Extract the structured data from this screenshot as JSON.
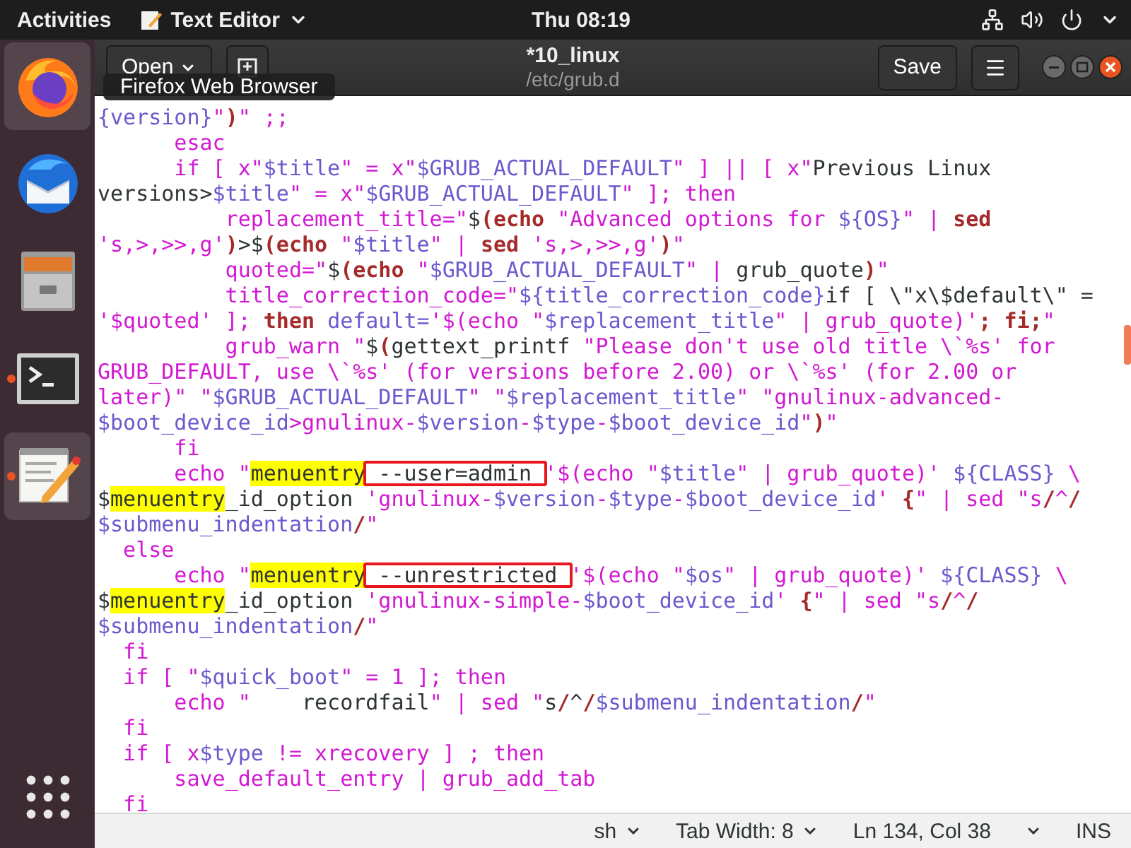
{
  "top_bar": {
    "activities": "Activities",
    "app_menu": "Text Editor",
    "clock": "Thu 08:19"
  },
  "dock": {
    "items": [
      {
        "kind": "firefox",
        "running": false,
        "highlighted": true
      },
      {
        "kind": "thunderbird",
        "running": false,
        "highlighted": false
      },
      {
        "kind": "files",
        "running": false,
        "highlighted": false
      },
      {
        "kind": "terminal",
        "running": true,
        "highlighted": false
      },
      {
        "kind": "text-editor",
        "running": true,
        "highlighted": true
      }
    ]
  },
  "tooltip": "Firefox Web Browser",
  "header": {
    "open_button": "Open",
    "title": "*10_linux",
    "subtitle": "/etc/grub.d",
    "save_button": "Save"
  },
  "editor": {
    "lines": [
      [
        {
          "kind": "variable",
          "text": "{version}"
        },
        {
          "kind": "string",
          "text": "\""
        },
        {
          "kind": "keyword",
          "text": ")"
        },
        {
          "kind": "string",
          "text": "\" ;;"
        }
      ],
      [
        {
          "kind": "string",
          "text": "      esac"
        }
      ],
      [
        {
          "kind": "string",
          "text": "      if [ x\""
        },
        {
          "kind": "variable",
          "text": "$title"
        },
        {
          "kind": "string",
          "text": "\" = x\""
        },
        {
          "kind": "variable",
          "text": "$GRUB_ACTUAL_DEFAULT"
        },
        {
          "kind": "string",
          "text": "\" ] || [ x\""
        },
        {
          "kind": "plain",
          "text": "Previous Linux"
        }
      ],
      [
        {
          "kind": "plain",
          "text": "versions>"
        },
        {
          "kind": "variable",
          "text": "$title"
        },
        {
          "kind": "string",
          "text": "\" = x\""
        },
        {
          "kind": "variable",
          "text": "$GRUB_ACTUAL_DEFAULT"
        },
        {
          "kind": "string",
          "text": "\" ]; then"
        }
      ],
      [
        {
          "kind": "string",
          "text": "          replacement_title=\""
        },
        {
          "kind": "plain",
          "text": "$"
        },
        {
          "kind": "keyword",
          "text": "(echo "
        },
        {
          "kind": "string",
          "text": "\"Advanced options for "
        },
        {
          "kind": "variable",
          "text": "${OS}"
        },
        {
          "kind": "string",
          "text": "\" | "
        },
        {
          "kind": "keyword",
          "text": "sed"
        }
      ],
      [
        {
          "kind": "string",
          "text": "'s,>,>>,g'"
        },
        {
          "kind": "keyword",
          "text": ")"
        },
        {
          "kind": "plain",
          "text": ">$"
        },
        {
          "kind": "keyword",
          "text": "(echo "
        },
        {
          "kind": "string",
          "text": "\""
        },
        {
          "kind": "variable",
          "text": "$title"
        },
        {
          "kind": "string",
          "text": "\" | "
        },
        {
          "kind": "keyword",
          "text": "sed "
        },
        {
          "kind": "string",
          "text": "'s,>,>>,g'"
        },
        {
          "kind": "keyword",
          "text": ")"
        },
        {
          "kind": "string",
          "text": "\""
        }
      ],
      [
        {
          "kind": "string",
          "text": "          quoted=\""
        },
        {
          "kind": "plain",
          "text": "$"
        },
        {
          "kind": "keyword",
          "text": "(echo "
        },
        {
          "kind": "string",
          "text": "\""
        },
        {
          "kind": "variable",
          "text": "$GRUB_ACTUAL_DEFAULT"
        },
        {
          "kind": "string",
          "text": "\" | "
        },
        {
          "kind": "plain",
          "text": "grub_quote"
        },
        {
          "kind": "keyword",
          "text": ")"
        },
        {
          "kind": "string",
          "text": "\""
        }
      ],
      [
        {
          "kind": "string",
          "text": "          title_correction_code=\""
        },
        {
          "kind": "variable",
          "text": "${title_correction_code}"
        },
        {
          "kind": "plain",
          "text": "if [ \\\"x\\$default\\\" ="
        }
      ],
      [
        {
          "kind": "string",
          "text": "'$quoted' ]; "
        },
        {
          "kind": "keyword",
          "text": "then "
        },
        {
          "kind": "variable",
          "text": "default="
        },
        {
          "kind": "string",
          "text": "'$(echo \""
        },
        {
          "kind": "variable",
          "text": "$replacement_title"
        },
        {
          "kind": "string",
          "text": "\" | grub_quote)'"
        },
        {
          "kind": "keyword",
          "text": "; fi;"
        },
        {
          "kind": "string",
          "text": "\""
        }
      ],
      [
        {
          "kind": "string",
          "text": "          grub_warn \""
        },
        {
          "kind": "plain",
          "text": "$"
        },
        {
          "kind": "keyword",
          "text": "("
        },
        {
          "kind": "plain",
          "text": "gettext_printf "
        },
        {
          "kind": "string",
          "text": "\"Please don't use old title \\`%s' for"
        }
      ],
      [
        {
          "kind": "string",
          "text": "GRUB_DEFAULT, use \\`%s' (for versions before 2.00) or \\`%s' (for 2.00 or"
        }
      ],
      [
        {
          "kind": "string",
          "text": "later)\" \""
        },
        {
          "kind": "variable",
          "text": "$GRUB_ACTUAL_DEFAULT"
        },
        {
          "kind": "string",
          "text": "\" \""
        },
        {
          "kind": "variable",
          "text": "$replacement_title"
        },
        {
          "kind": "string",
          "text": "\" \"gnulinux-advanced-"
        }
      ],
      [
        {
          "kind": "variable",
          "text": "$boot_device_id"
        },
        {
          "kind": "string",
          "text": ">gnulinux-"
        },
        {
          "kind": "variable",
          "text": "$version"
        },
        {
          "kind": "string",
          "text": "-"
        },
        {
          "kind": "variable",
          "text": "$type"
        },
        {
          "kind": "string",
          "text": "-"
        },
        {
          "kind": "variable",
          "text": "$boot_device_id"
        },
        {
          "kind": "string",
          "text": "\""
        },
        {
          "kind": "keyword",
          "text": ")"
        },
        {
          "kind": "string",
          "text": "\""
        }
      ],
      [
        {
          "kind": "string",
          "text": "      fi"
        }
      ],
      [
        {
          "kind": "string",
          "text": "      echo \""
        },
        {
          "kind": "match",
          "text": "menuentry"
        },
        {
          "kind": "marked",
          "text": " --user=admin "
        },
        {
          "kind": "string",
          "text": "'$(echo \""
        },
        {
          "kind": "variable",
          "text": "$title"
        },
        {
          "kind": "string",
          "text": "\" | grub_quote)' "
        },
        {
          "kind": "variable",
          "text": "${CLASS}"
        },
        {
          "kind": "string",
          "text": " \\"
        }
      ],
      [
        {
          "kind": "plain",
          "text": "$"
        },
        {
          "kind": "match",
          "text": "menuentry"
        },
        {
          "kind": "plain",
          "text": "_id_option "
        },
        {
          "kind": "string",
          "text": "'gnulinux-"
        },
        {
          "kind": "variable",
          "text": "$version"
        },
        {
          "kind": "string",
          "text": "-"
        },
        {
          "kind": "variable",
          "text": "$type"
        },
        {
          "kind": "string",
          "text": "-"
        },
        {
          "kind": "variable",
          "text": "$boot_device_id"
        },
        {
          "kind": "string",
          "text": "' "
        },
        {
          "kind": "keyword",
          "text": "{"
        },
        {
          "kind": "string",
          "text": "\" | sed \"s"
        },
        {
          "kind": "keyword",
          "text": "/"
        },
        {
          "kind": "string",
          "text": "^"
        },
        {
          "kind": "keyword",
          "text": "/"
        }
      ],
      [
        {
          "kind": "variable",
          "text": "$submenu_indentation"
        },
        {
          "kind": "keyword",
          "text": "/"
        },
        {
          "kind": "string",
          "text": "\""
        }
      ],
      [
        {
          "kind": "string",
          "text": "  else"
        }
      ],
      [
        {
          "kind": "string",
          "text": "      echo \""
        },
        {
          "kind": "match",
          "text": "menuentry"
        },
        {
          "kind": "marked",
          "text": " --unrestricted "
        },
        {
          "kind": "string",
          "text": "'$(echo \""
        },
        {
          "kind": "variable",
          "text": "$os"
        },
        {
          "kind": "string",
          "text": "\" | grub_quote)' "
        },
        {
          "kind": "variable",
          "text": "${CLASS}"
        },
        {
          "kind": "string",
          "text": " \\"
        }
      ],
      [
        {
          "kind": "plain",
          "text": "$"
        },
        {
          "kind": "match",
          "text": "menuentry"
        },
        {
          "kind": "plain",
          "text": "_id_option "
        },
        {
          "kind": "string",
          "text": "'gnulinux-simple-"
        },
        {
          "kind": "variable",
          "text": "$boot_device_id"
        },
        {
          "kind": "string",
          "text": "' "
        },
        {
          "kind": "keyword",
          "text": "{"
        },
        {
          "kind": "string",
          "text": "\" | sed \"s"
        },
        {
          "kind": "keyword",
          "text": "/"
        },
        {
          "kind": "string",
          "text": "^"
        },
        {
          "kind": "keyword",
          "text": "/"
        }
      ],
      [
        {
          "kind": "variable",
          "text": "$submenu_indentation"
        },
        {
          "kind": "keyword",
          "text": "/"
        },
        {
          "kind": "string",
          "text": "\""
        }
      ],
      [
        {
          "kind": "string",
          "text": "  fi"
        }
      ],
      [
        {
          "kind": "string",
          "text": "  if [ \""
        },
        {
          "kind": "variable",
          "text": "$quick_boot"
        },
        {
          "kind": "string",
          "text": "\" = 1 ]; then"
        }
      ],
      [
        {
          "kind": "string",
          "text": "      echo \""
        },
        {
          "kind": "plain",
          "text": "    recordfail"
        },
        {
          "kind": "string",
          "text": "\" | sed \""
        },
        {
          "kind": "plain",
          "text": "s"
        },
        {
          "kind": "keyword",
          "text": "/"
        },
        {
          "kind": "plain",
          "text": "^"
        },
        {
          "kind": "keyword",
          "text": "/"
        },
        {
          "kind": "variable",
          "text": "$submenu_indentation"
        },
        {
          "kind": "keyword",
          "text": "/"
        },
        {
          "kind": "string",
          "text": "\""
        }
      ],
      [
        {
          "kind": "string",
          "text": "  fi"
        }
      ],
      [
        {
          "kind": "string",
          "text": "  if [ x"
        },
        {
          "kind": "variable",
          "text": "$type"
        },
        {
          "kind": "string",
          "text": " != xrecovery ] ; then"
        }
      ],
      [
        {
          "kind": "string",
          "text": "      save_default_entry | grub_add_tab"
        }
      ],
      [
        {
          "kind": "string",
          "text": "  fi"
        }
      ]
    ]
  },
  "status_bar": {
    "language": "sh",
    "tab_width": "Tab Width: 8",
    "position": "Ln 134, Col 38",
    "mode": "INS"
  }
}
